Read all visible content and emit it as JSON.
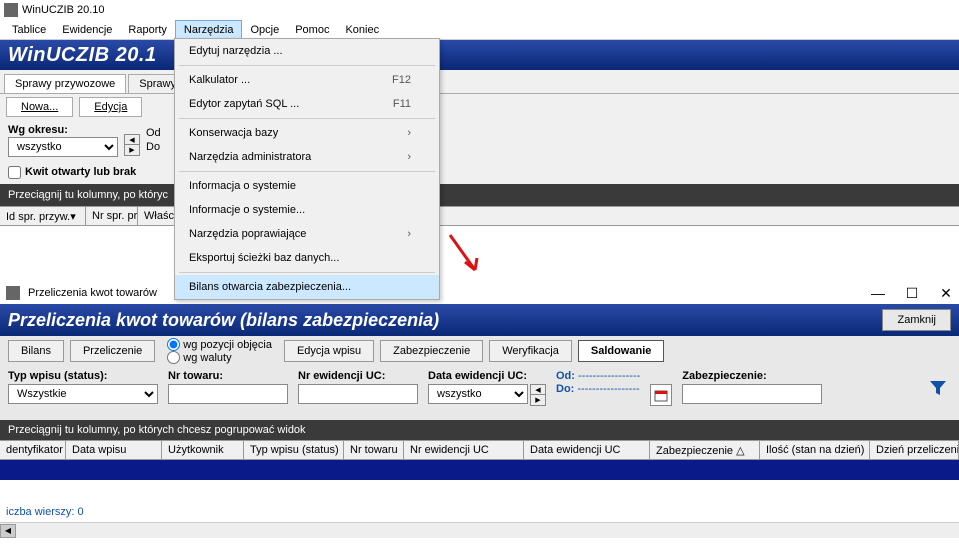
{
  "app": {
    "title": "WinUCZIB 20.10",
    "banner": "WinUCZIB 20.1"
  },
  "menubar": [
    "Tablice",
    "Ewidencje",
    "Raporty",
    "Narzędzia",
    "Opcje",
    "Pomoc",
    "Koniec"
  ],
  "menubar_active_index": 3,
  "dropdown": {
    "items": [
      {
        "label": "Edytuj narzędzia ...",
        "shortcut": "",
        "arrow": false
      },
      {
        "sep": true
      },
      {
        "label": "Kalkulator ...",
        "shortcut": "F12",
        "arrow": false
      },
      {
        "label": "Edytor zapytań SQL ...",
        "shortcut": "F11",
        "arrow": false
      },
      {
        "sep": true
      },
      {
        "label": "Konserwacja bazy",
        "shortcut": "",
        "arrow": true
      },
      {
        "label": "Narzędzia administratora",
        "shortcut": "",
        "arrow": true
      },
      {
        "sep": true
      },
      {
        "label": "Informacja o systemie",
        "shortcut": "",
        "arrow": false
      },
      {
        "label": "Informacje o systemie...",
        "shortcut": "",
        "arrow": false
      },
      {
        "label": "Narzędzia poprawiające",
        "shortcut": "",
        "arrow": true
      },
      {
        "label": "Eksportuj ścieżki baz danych...",
        "shortcut": "",
        "arrow": false
      },
      {
        "sep": true
      },
      {
        "label": "Bilans otwarcia zabezpieczenia...",
        "shortcut": "",
        "arrow": false,
        "highlighted": true
      }
    ]
  },
  "tabs1": {
    "tab_a": "Sprawy przywozowe",
    "tab_b": "Sprawy"
  },
  "toolbar1": {
    "nowa": "Nowa...",
    "edycja": "Edycja"
  },
  "filters1": {
    "wg_okresu_label": "Wg okresu:",
    "wg_okresu_value": "wszystko",
    "od_label": "Od",
    "do_label": "Do",
    "checkbox_label": "Kwit otwarty lub brak"
  },
  "groupbar1": "Przeciągnij tu kolumny, po któryc",
  "cols1": {
    "c1": "Id spr. przyw.▾",
    "c2": "Nr spr. pr",
    "c3": "Właści"
  },
  "win2": {
    "title": "Przeliczenia kwot towarów",
    "banner": "Przeliczenia kwot towarów (bilans zabezpieczenia)",
    "close_btn": "Zamknij",
    "buttons": {
      "bilans": "Bilans",
      "przeliczenie": "Przeliczenie",
      "edycja": "Edycja wpisu",
      "zabezpieczenie": "Zabezpieczenie",
      "weryfikacja": "Weryfikacja",
      "saldowanie": "Saldowanie"
    },
    "radios": {
      "r1": "wg pozycji objęcia",
      "r2": "wg waluty"
    },
    "fields": {
      "typ_label": "Typ wpisu (status):",
      "typ_value": "Wszystkie",
      "nr_towaru_label": "Nr towaru:",
      "nr_ewid_label": "Nr ewidencji UC:",
      "data_ewid_label": "Data ewidencji UC:",
      "data_ewid_value": "wszystko",
      "od_label": "Od:",
      "do_label": "Do:",
      "od_value": "-----------------",
      "do_value": "-----------------",
      "zabezp_label": "Zabezpieczenie:"
    },
    "groupbar": "Przeciągnij tu kolumny, po których chcesz pogrupować widok",
    "cols": {
      "c1": "dentyfikator",
      "c2": "Data wpisu",
      "c3": "Użytkownik",
      "c4": "Typ wpisu (status)",
      "c5": "Nr towaru",
      "c6": "Nr ewidencji UC",
      "c7": "Data ewidencji UC",
      "c8": "Zabezpieczenie △",
      "c9": "Ilość (stan na dzień)",
      "c10": "Dzień przeliczeni..."
    },
    "status": "iczba wierszy: 0"
  }
}
